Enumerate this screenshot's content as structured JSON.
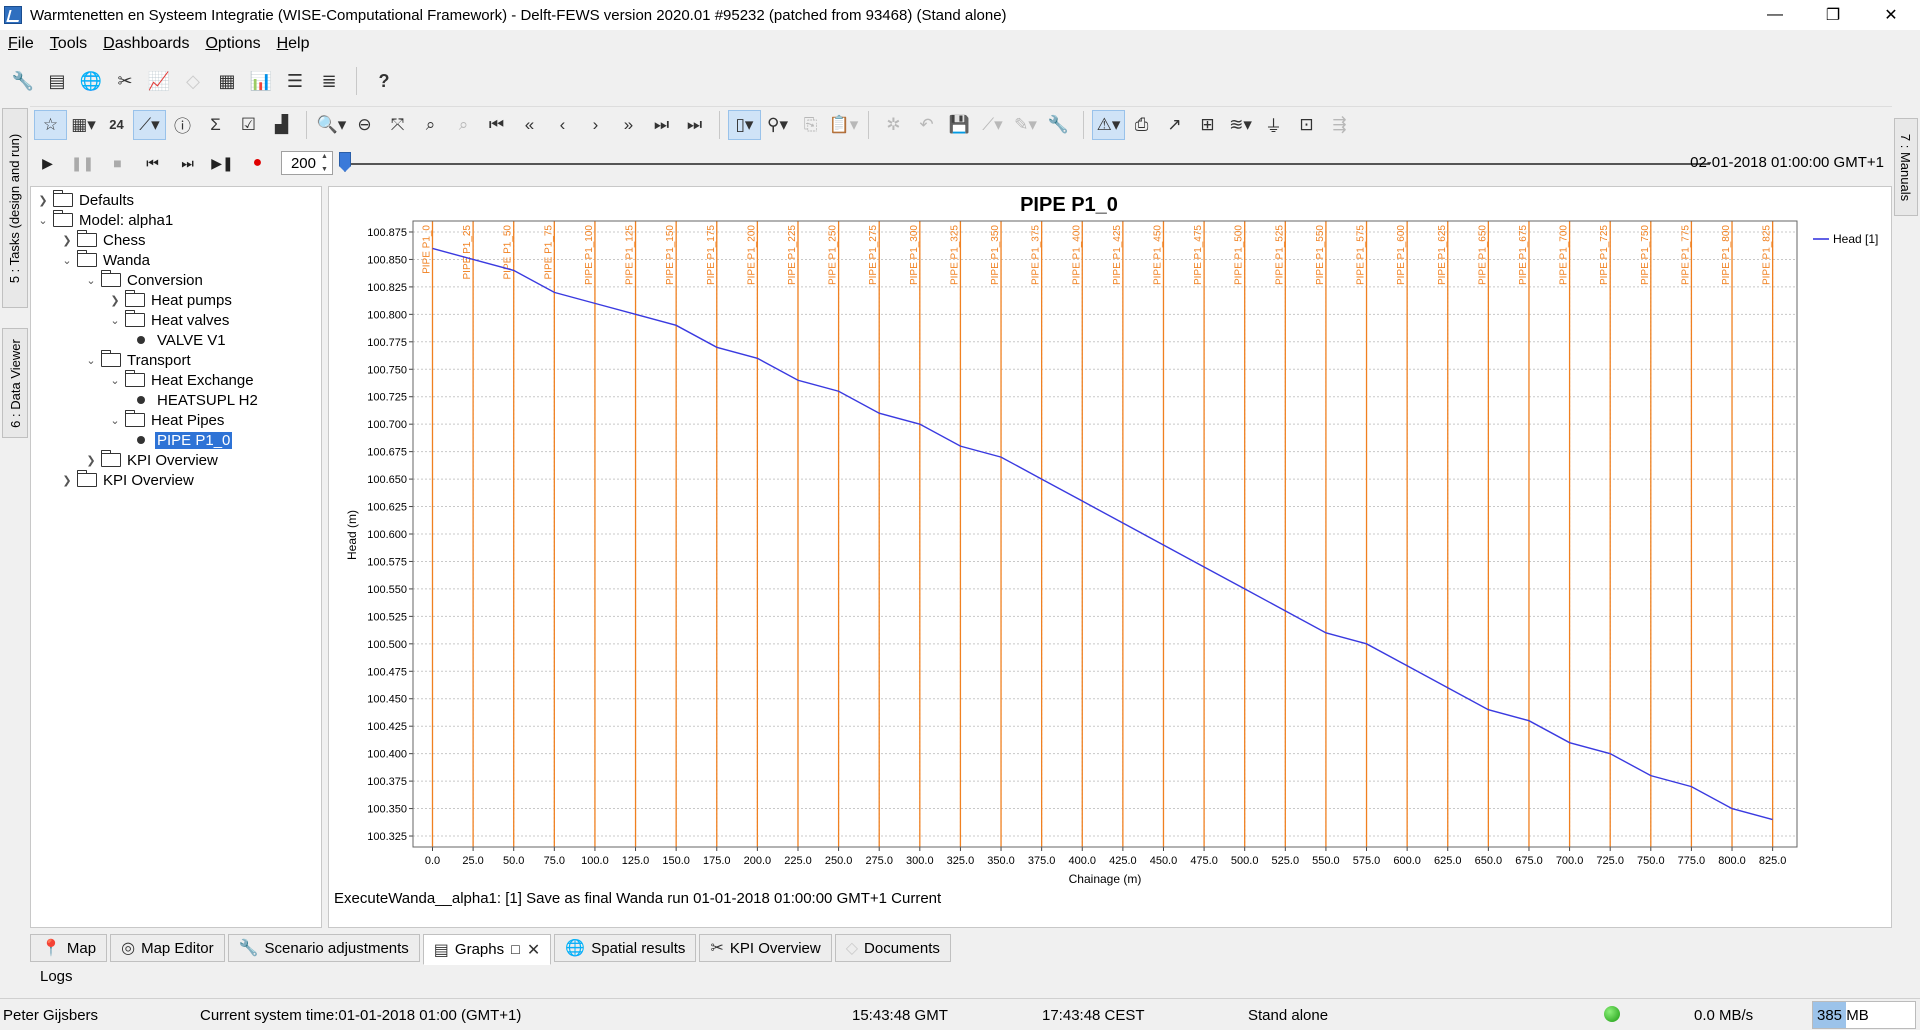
{
  "window": {
    "title": "Warmtenetten en Systeem Integratie (WISE-Computational Framework) - Delft-FEWS version 2020.01 #95232 (patched from 93468)  (Stand alone)"
  },
  "menu": [
    {
      "pre": "",
      "ul": "F",
      "post": "ile"
    },
    {
      "pre": "",
      "ul": "T",
      "post": "ools"
    },
    {
      "pre": "",
      "ul": "D",
      "post": "ashboards"
    },
    {
      "pre": "",
      "ul": "O",
      "post": "ptions"
    },
    {
      "pre": "",
      "ul": "H",
      "post": "elp"
    }
  ],
  "toolbar": {
    "help_label": "?",
    "hours_label": "24"
  },
  "side_tabs": {
    "tasks": "5 : Tasks (design and run)",
    "data_viewer": "6 : Data Viewer",
    "manuals": "7 : Manuals"
  },
  "playbar": {
    "step": "200",
    "time": "02-01-2018 01:00:00 GMT+1"
  },
  "tree": {
    "defaults": "Defaults",
    "model": "Model: alpha1",
    "chess": "Chess",
    "wanda": "Wanda",
    "conversion": "Conversion",
    "heat_pumps": "Heat pumps",
    "heat_valves": "Heat valves",
    "valve_v1": "VALVE V1",
    "transport": "Transport",
    "heat_exchange": "Heat Exchange",
    "heatsupl": "HEATSUPL H2",
    "heat_pipes": "Heat Pipes",
    "pipe_p1": "PIPE P1_0",
    "kpi_inner": "KPI Overview",
    "kpi_outer": "KPI Overview"
  },
  "chart_data": {
    "type": "line",
    "title": "PIPE P1_0",
    "xlabel": "Chainage (m)",
    "ylabel": "Head (m)",
    "xlim": [
      -12,
      840
    ],
    "ylim": [
      100.315,
      100.885
    ],
    "x_ticks": [
      0,
      25,
      50,
      75,
      100,
      125,
      150,
      175,
      200,
      225,
      250,
      275,
      300,
      325,
      350,
      375,
      400,
      425,
      450,
      475,
      500,
      525,
      550,
      575,
      600,
      625,
      650,
      675,
      700,
      725,
      750,
      775,
      800,
      825
    ],
    "y_ticks": [
      100.325,
      100.35,
      100.375,
      100.4,
      100.425,
      100.45,
      100.475,
      100.5,
      100.525,
      100.55,
      100.575,
      100.6,
      100.625,
      100.65,
      100.675,
      100.7,
      100.725,
      100.75,
      100.775,
      100.8,
      100.825,
      100.85,
      100.875
    ],
    "grid": true,
    "legend": "top-right",
    "series": [
      {
        "name": "Head [1]",
        "color": "#3a3ae0",
        "x": [
          0,
          25,
          50,
          75,
          100,
          125,
          150,
          175,
          200,
          225,
          250,
          275,
          300,
          325,
          350,
          375,
          400,
          425,
          450,
          475,
          500,
          525,
          550,
          575,
          600,
          625,
          650,
          675,
          700,
          725,
          750,
          775,
          800,
          825
        ],
        "y": [
          100.86,
          100.85,
          100.84,
          100.82,
          100.81,
          100.8,
          100.79,
          100.77,
          100.76,
          100.74,
          100.73,
          100.71,
          100.7,
          100.68,
          100.67,
          100.65,
          100.63,
          100.61,
          100.59,
          100.57,
          100.55,
          100.53,
          100.51,
          100.5,
          100.48,
          100.46,
          100.44,
          100.43,
          100.41,
          100.4,
          100.38,
          100.37,
          100.35,
          100.34
        ]
      }
    ],
    "markers": {
      "color": "#f08020",
      "x": [
        0,
        25,
        50,
        75,
        100,
        125,
        150,
        175,
        200,
        225,
        250,
        275,
        300,
        325,
        350,
        375,
        400,
        425,
        450,
        475,
        500,
        525,
        550,
        575,
        600,
        625,
        650,
        675,
        700,
        725,
        750,
        775,
        800,
        825
      ],
      "labels": [
        "PIPE P1_0",
        "PIPE P1_25",
        "PIPE P1_50",
        "PIPE P1_75",
        "PIPE P1_100",
        "PIPE P1_125",
        "PIPE P1_150",
        "PIPE P1_175",
        "PIPE P1_200",
        "PIPE P1_225",
        "PIPE P1_250",
        "PIPE P1_275",
        "PIPE P1_300",
        "PIPE P1_325",
        "PIPE P1_350",
        "PIPE P1_375",
        "PIPE P1_400",
        "PIPE P1_425",
        "PIPE P1_450",
        "PIPE P1_475",
        "PIPE P1_500",
        "PIPE P1_525",
        "PIPE P1_550",
        "PIPE P1_575",
        "PIPE P1_600",
        "PIPE P1_625",
        "PIPE P1_650",
        "PIPE P1_675",
        "PIPE P1_700",
        "PIPE P1_725",
        "PIPE P1_750",
        "PIPE P1_775",
        "PIPE P1_800",
        "PIPE P1_825"
      ]
    }
  },
  "graph_status": "ExecuteWanda__alpha1: [1] Save as final Wanda run 01-01-2018 01:00:00 GMT+1 Current",
  "bottom_tabs": {
    "map": "Map",
    "map_editor": "Map Editor",
    "scenario": "Scenario adjustments",
    "graphs": "Graphs",
    "spatial": "Spatial results",
    "kpi": "KPI Overview",
    "documents": "Documents"
  },
  "logs": "Logs",
  "statusbar": {
    "user": "Peter Gijsbers",
    "system_time": "Current system time:01-01-2018 01:00 (GMT+1)",
    "gmt": "15:43:48 GMT",
    "cest": "17:43:48 CEST",
    "mode": "Stand alone",
    "rate": "0.0 MB/s",
    "memory": "385 MB",
    "memory_fraction": 0.32
  }
}
